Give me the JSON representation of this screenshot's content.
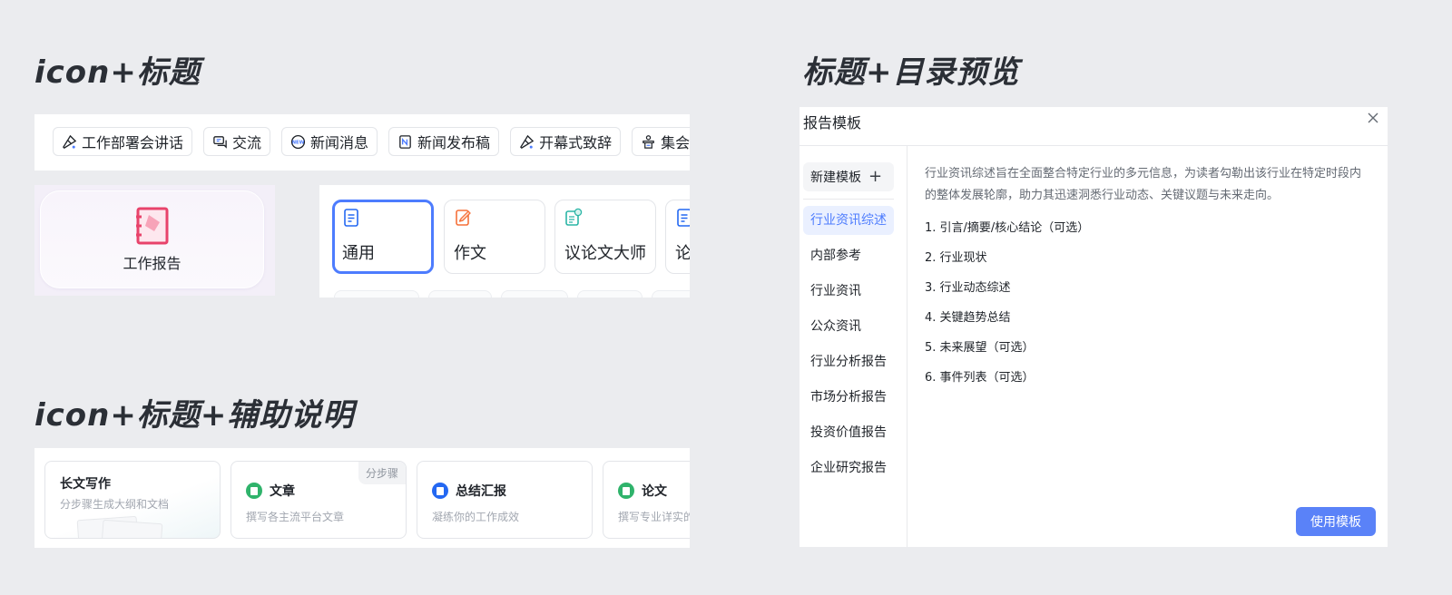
{
  "sections": {
    "icon_title": "icon+标题",
    "icon_title_desc": "icon+标题+辅助说明",
    "title_toc_preview": "标题+目录预览"
  },
  "chips": [
    {
      "label": "工作部署会讲话",
      "icon": "microphone-icon"
    },
    {
      "label": "交流",
      "icon": "chat-icon"
    },
    {
      "label": "新闻消息",
      "icon": "new-badge-icon"
    },
    {
      "label": "新闻发布稿",
      "icon": "newspaper-icon"
    },
    {
      "label": "开幕式致辞",
      "icon": "microphone-icon"
    },
    {
      "label": "集会演",
      "icon": "podium-icon"
    }
  ],
  "report_card": {
    "label": "工作报告",
    "icon": "notebook-icon"
  },
  "tiles": [
    {
      "label": "通用",
      "icon": "document-icon"
    },
    {
      "label": "作文",
      "icon": "edit-document-icon"
    },
    {
      "label": "议论文大师",
      "icon": "document-star-icon"
    },
    {
      "label": "论",
      "icon": "document-icon"
    }
  ],
  "writing_cards": [
    {
      "title": "长文写作",
      "desc": "分步骤生成大纲和文档"
    },
    {
      "title": "文章",
      "desc": "撰写各主流平台文章",
      "tag": "分步骤",
      "icon": "article-icon"
    },
    {
      "title": "总结汇报",
      "desc": "凝练你的工作成效",
      "icon": "summary-icon"
    },
    {
      "title": "论文",
      "desc": "撰写专业详实的",
      "icon": "paper-chart-icon"
    }
  ],
  "dialog": {
    "title": "报告模板",
    "new_template": "新建模板",
    "categories": [
      "行业资讯综述",
      "内部参考",
      "行业资讯",
      "公众资讯",
      "行业分析报告",
      "市场分析报告",
      "投资价值报告",
      "企业研究报告"
    ],
    "active_category": "行业资讯综述",
    "description": "行业资讯综述旨在全面整合特定行业的多元信息，为读者勾勒出该行业在特定时段内的整体发展轮廓，助力其迅速洞悉行业动态、关键议题与未来走向。",
    "outline": [
      "1. 引言/摘要/核心结论（可选）",
      "2. 行业现状",
      "3. 行业动态综述",
      "4. 关键趋势总结",
      "5. 未来展望（可选）",
      "6. 事件列表（可选）"
    ],
    "use_button": "使用模板"
  },
  "colors": {
    "accent": "#4d7cfe",
    "button": "#5a82f8",
    "report_icon": "#e8436b",
    "green": "#2fb36b",
    "blue": "#2468f2",
    "orange": "#f5713a",
    "teal": "#2bb5a6"
  }
}
